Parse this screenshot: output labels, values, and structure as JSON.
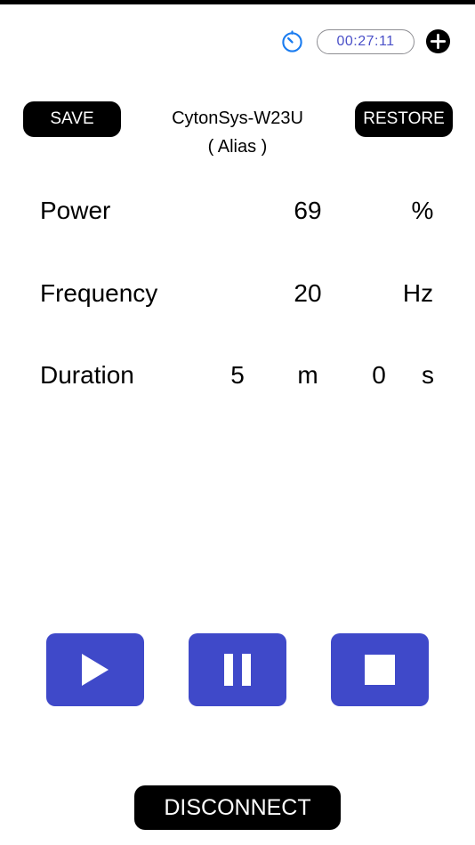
{
  "header": {
    "timer": "00:27:11",
    "timer_color": "#4a50c8",
    "icons": {
      "timer": "timer-icon",
      "add": "add-circle-icon"
    }
  },
  "device": {
    "save_label": "SAVE",
    "restore_label": "RESTORE",
    "name": "CytonSys-W23U",
    "alias": "( Alias )"
  },
  "params": {
    "power": {
      "label": "Power",
      "value": "69",
      "unit": "%"
    },
    "frequency": {
      "label": "Frequency",
      "value": "20",
      "unit": "Hz"
    },
    "duration": {
      "label": "Duration",
      "minutes": "5",
      "minutes_unit": "m",
      "seconds": "0",
      "seconds_unit": "s"
    }
  },
  "controls": {
    "accent": "#3f49c9",
    "icons": {
      "play": "play-icon",
      "pause": "pause-icon",
      "stop": "stop-icon"
    }
  },
  "footer": {
    "disconnect_label": "DISCONNECT"
  }
}
